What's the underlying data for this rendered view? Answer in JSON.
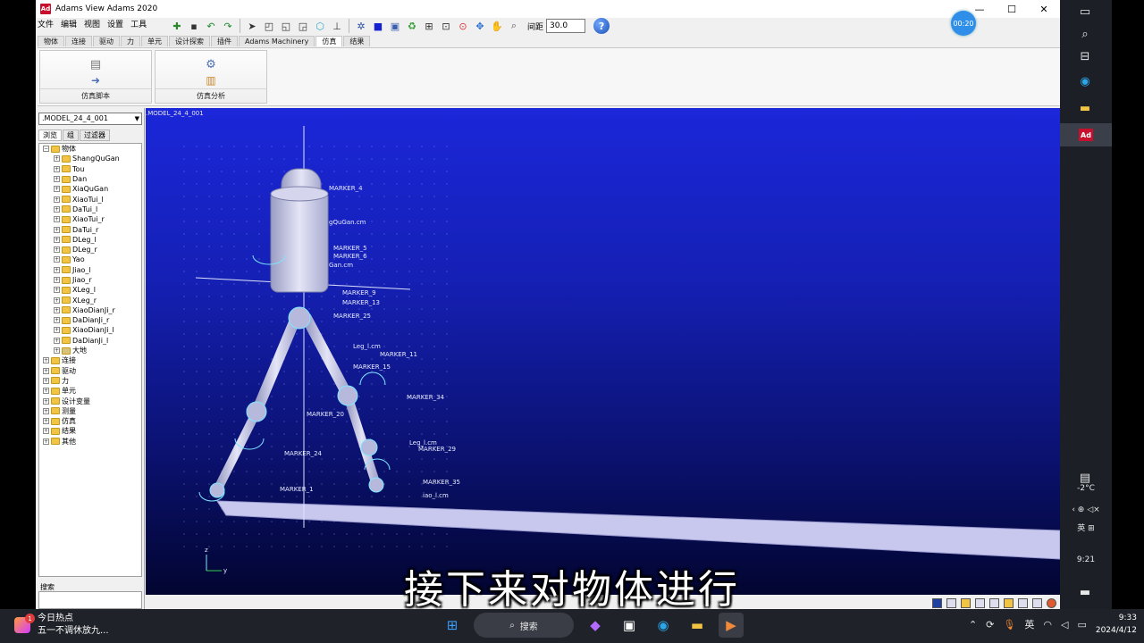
{
  "window": {
    "title": "Adams View Adams 2020",
    "timer": "00:20"
  },
  "menu": [
    "文件",
    "编辑",
    "视图",
    "设置",
    "工具"
  ],
  "toolbar": {
    "spacing_label": "间距",
    "spacing_value": "30.0"
  },
  "tabs": [
    "物体",
    "连接",
    "驱动",
    "力",
    "单元",
    "设计探索",
    "插件",
    "Adams Machinery",
    "仿真",
    "结果"
  ],
  "active_tab": "仿真",
  "ribbon": [
    {
      "label": "仿真脚本",
      "icon": "script-icon"
    },
    {
      "label": "仿真分析",
      "icon": "gear-analysis-icon"
    }
  ],
  "sidebar": {
    "model": ".MODEL_24_4_001",
    "tabs": [
      "浏览",
      "组",
      "过滤器"
    ],
    "tree": [
      {
        "label": "物体",
        "level": 0,
        "exp": "−",
        "ground": false
      },
      {
        "label": "ShangQuGan",
        "level": 1,
        "exp": "+",
        "ground": false
      },
      {
        "label": "Tou",
        "level": 1,
        "exp": "+",
        "ground": false
      },
      {
        "label": "Dan",
        "level": 1,
        "exp": "+",
        "ground": false
      },
      {
        "label": "XiaQuGan",
        "level": 1,
        "exp": "+",
        "ground": false
      },
      {
        "label": "XiaoTui_l",
        "level": 1,
        "exp": "+",
        "ground": false
      },
      {
        "label": "DaTui_l",
        "level": 1,
        "exp": "+",
        "ground": false
      },
      {
        "label": "XiaoTui_r",
        "level": 1,
        "exp": "+",
        "ground": false
      },
      {
        "label": "DaTui_r",
        "level": 1,
        "exp": "+",
        "ground": false
      },
      {
        "label": "DLeg_l",
        "level": 1,
        "exp": "+",
        "ground": false
      },
      {
        "label": "DLeg_r",
        "level": 1,
        "exp": "+",
        "ground": false
      },
      {
        "label": "Yao",
        "level": 1,
        "exp": "+",
        "ground": false
      },
      {
        "label": "Jiao_l",
        "level": 1,
        "exp": "+",
        "ground": false
      },
      {
        "label": "Jiao_r",
        "level": 1,
        "exp": "+",
        "ground": false
      },
      {
        "label": "XLeg_l",
        "level": 1,
        "exp": "+",
        "ground": false
      },
      {
        "label": "XLeg_r",
        "level": 1,
        "exp": "+",
        "ground": false
      },
      {
        "label": "XiaoDianJi_r",
        "level": 1,
        "exp": "+",
        "ground": false
      },
      {
        "label": "DaDianJi_r",
        "level": 1,
        "exp": "+",
        "ground": false
      },
      {
        "label": "XiaoDianJi_l",
        "level": 1,
        "exp": "+",
        "ground": false
      },
      {
        "label": "DaDianJi_l",
        "level": 1,
        "exp": "+",
        "ground": false
      },
      {
        "label": "大地",
        "level": 1,
        "exp": "+",
        "ground": true
      },
      {
        "label": "连接",
        "level": 0,
        "exp": "+",
        "ground": false
      },
      {
        "label": "驱动",
        "level": 0,
        "exp": "+",
        "ground": false
      },
      {
        "label": "力",
        "level": 0,
        "exp": "+",
        "ground": false
      },
      {
        "label": "单元",
        "level": 0,
        "exp": "+",
        "ground": false
      },
      {
        "label": "设计变量",
        "level": 0,
        "exp": "+",
        "ground": false
      },
      {
        "label": "测量",
        "level": 0,
        "exp": "+",
        "ground": false
      },
      {
        "label": "仿真",
        "level": 0,
        "exp": "+",
        "ground": false
      },
      {
        "label": "结果",
        "level": 0,
        "exp": "+",
        "ground": false
      },
      {
        "label": "其他",
        "level": 0,
        "exp": "+",
        "ground": false
      }
    ],
    "search_label": "搜索"
  },
  "viewport": {
    "model_label": ".MODEL_24_4_001",
    "annotations": [
      "MARKER_4",
      "gQuGan.cm",
      "MARKER_5",
      "MARKER_6",
      "Gan.cm",
      "MARKER_9",
      "MARKER_13",
      "MARKER_25",
      "Leg_l.cm",
      "MARKER_11",
      "MARKER_15",
      "MARKER_34",
      "MARKER_20",
      "Leg_l.cm",
      "MARKER_29",
      "MARKER_24",
      "MARKER_1",
      "MARKER_35",
      "iao_l.cm"
    ],
    "axis": {
      "z": "z",
      "y": "y"
    }
  },
  "subtitle": "接下来对物体进行",
  "right_panel": {
    "temp": "-2°C",
    "lang": "英",
    "time": "9:21"
  },
  "taskbar": {
    "news_title": "今日热点",
    "news_sub": "五一不调休放九...",
    "news_badge": "1",
    "search": "搜索",
    "lang": "英",
    "time": "9:33",
    "date": "2024/4/12"
  },
  "colors": {
    "viewport_top": "#1b27d9",
    "viewport_bottom": "#020530",
    "model_body": "#c9cbe6",
    "marker": "#7fe6ff"
  }
}
